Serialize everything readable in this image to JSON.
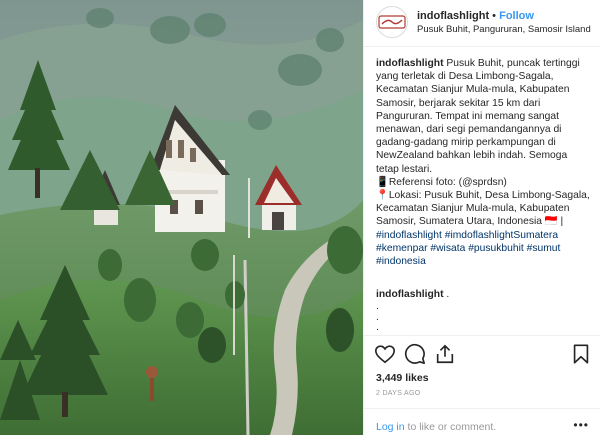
{
  "post": {
    "username": "indoflashlight",
    "follow_label": "Follow",
    "separator": "•",
    "location": "Pusuk Buhit, Pangururan, Samosir Island"
  },
  "caption": {
    "username": "indoflashlight",
    "body_1": " Pusuk Buhit, puncak tertinggi yang terletak di Desa Limbong-Sagala, Kecamatan Sianjur Mula-mula, Kabupaten Samosir, berjarak sekitar 15 km dari Pangururan. Tempat ini memang sangat menawan, dari segi pemandangannya di gadang-gadang mirip perkampungan di NewZealand bahkan lebih indah. Semoga tetap lestari.",
    "ref_line": "📱Referensi foto: (@sprdsn)",
    "loc_line": "📍Lokasi: Pusuk Buhit, Desa Limbong-Sagala, Kecamatan Sianjur Mula-mula, Kabupaten Samosir, Sumatera Utara, Indonesia 🇮🇩 | ",
    "hashtags": [
      "#indoflashlight",
      "#imdoflashlightSumatera",
      "#kemenpar",
      "#wisata",
      "#pusukbuhit",
      "#sumut",
      "#indonesia"
    ]
  },
  "comment": {
    "username": "indoflashlight",
    "text": " ."
  },
  "comment_dots": [
    ".",
    ".",
    "."
  ],
  "stats": {
    "likes": "3,449 likes",
    "posted": "2 DAYS AGO"
  },
  "footer": {
    "login_link": "Log in",
    "login_text": " to like or comment.",
    "more": "•••"
  },
  "icons": {
    "like": "heart-icon",
    "comment": "comment-icon",
    "share": "share-icon",
    "save": "bookmark-icon",
    "more": "more-options-icon"
  },
  "colors": {
    "link": "#3897f0",
    "hashtag": "#003569",
    "muted": "#999999",
    "text": "#262626"
  }
}
